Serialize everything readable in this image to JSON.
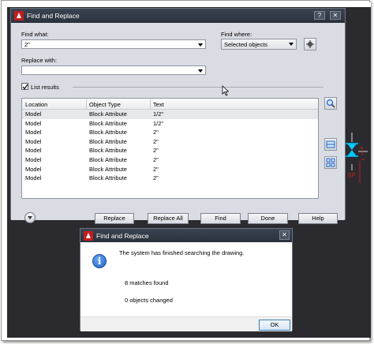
{
  "main_dialog": {
    "title": "Find and Replace",
    "help_glyph": "?",
    "close_glyph": "✕",
    "find_what": {
      "label": "Find what:",
      "value": "2\""
    },
    "find_where": {
      "label": "Find where:",
      "value": "Selected objects"
    },
    "replace_with": {
      "label": "Replace with:",
      "value": ""
    },
    "list_results": {
      "label": "List results",
      "checked": true
    },
    "list": {
      "columns": [
        "Location",
        "Object Type",
        "Text"
      ],
      "rows": [
        [
          "Model",
          "Block Attribute",
          "1/2\""
        ],
        [
          "Model",
          "Block Attribute",
          "1/2\""
        ],
        [
          "Model",
          "Block Attribute",
          "2\""
        ],
        [
          "Model",
          "Block Attribute",
          "2\""
        ],
        [
          "Model",
          "Block Attribute",
          "2\""
        ],
        [
          "Model",
          "Block Attribute",
          "2\""
        ],
        [
          "Model",
          "Block Attribute",
          "2\""
        ],
        [
          "Model",
          "Block Attribute",
          "2\""
        ]
      ]
    },
    "buttons": {
      "replace": "Replace",
      "replace_all": "Replace All",
      "find": "Find",
      "done": "Done",
      "help": "Help"
    }
  },
  "message_box": {
    "title": "Find and Replace",
    "close_glyph": "✕",
    "icon": "info-icon",
    "line1": "The system has finished searching the drawing.",
    "line2": "8 matches found",
    "line3": "0 objects changed",
    "ok": "OK"
  },
  "cad_label": "SP",
  "colors": {
    "title_bar": "#2f3744",
    "dialog_bg": "#d9dce2",
    "canvas_bg": "#2b2b2f",
    "accent_red": "#c21e1e",
    "cad_cyan": "#00c8ff"
  }
}
